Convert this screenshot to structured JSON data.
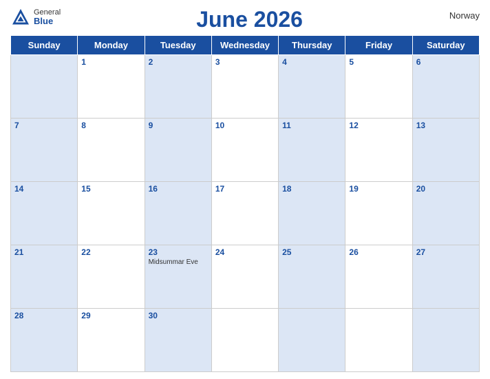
{
  "header": {
    "logo": {
      "general": "General",
      "blue": "Blue"
    },
    "title": "June 2026",
    "country": "Norway"
  },
  "weekdays": [
    "Sunday",
    "Monday",
    "Tuesday",
    "Wednesday",
    "Thursday",
    "Friday",
    "Saturday"
  ],
  "weeks": [
    [
      {
        "day": "",
        "bg": "blue"
      },
      {
        "day": "1",
        "bg": "white"
      },
      {
        "day": "2",
        "bg": "blue"
      },
      {
        "day": "3",
        "bg": "white"
      },
      {
        "day": "4",
        "bg": "blue"
      },
      {
        "day": "5",
        "bg": "white"
      },
      {
        "day": "6",
        "bg": "blue"
      }
    ],
    [
      {
        "day": "7",
        "bg": "blue"
      },
      {
        "day": "8",
        "bg": "white"
      },
      {
        "day": "9",
        "bg": "blue"
      },
      {
        "day": "10",
        "bg": "white"
      },
      {
        "day": "11",
        "bg": "blue"
      },
      {
        "day": "12",
        "bg": "white"
      },
      {
        "day": "13",
        "bg": "blue"
      }
    ],
    [
      {
        "day": "14",
        "bg": "blue"
      },
      {
        "day": "15",
        "bg": "white"
      },
      {
        "day": "16",
        "bg": "blue"
      },
      {
        "day": "17",
        "bg": "white"
      },
      {
        "day": "18",
        "bg": "blue"
      },
      {
        "day": "19",
        "bg": "white"
      },
      {
        "day": "20",
        "bg": "blue"
      }
    ],
    [
      {
        "day": "21",
        "bg": "blue"
      },
      {
        "day": "22",
        "bg": "white"
      },
      {
        "day": "23",
        "bg": "blue",
        "event": "Midsummar Eve"
      },
      {
        "day": "24",
        "bg": "white"
      },
      {
        "day": "25",
        "bg": "blue"
      },
      {
        "day": "26",
        "bg": "white"
      },
      {
        "day": "27",
        "bg": "blue"
      }
    ],
    [
      {
        "day": "28",
        "bg": "blue"
      },
      {
        "day": "29",
        "bg": "white"
      },
      {
        "day": "30",
        "bg": "blue"
      },
      {
        "day": "",
        "bg": "white"
      },
      {
        "day": "",
        "bg": "blue"
      },
      {
        "day": "",
        "bg": "white"
      },
      {
        "day": "",
        "bg": "blue"
      }
    ]
  ]
}
